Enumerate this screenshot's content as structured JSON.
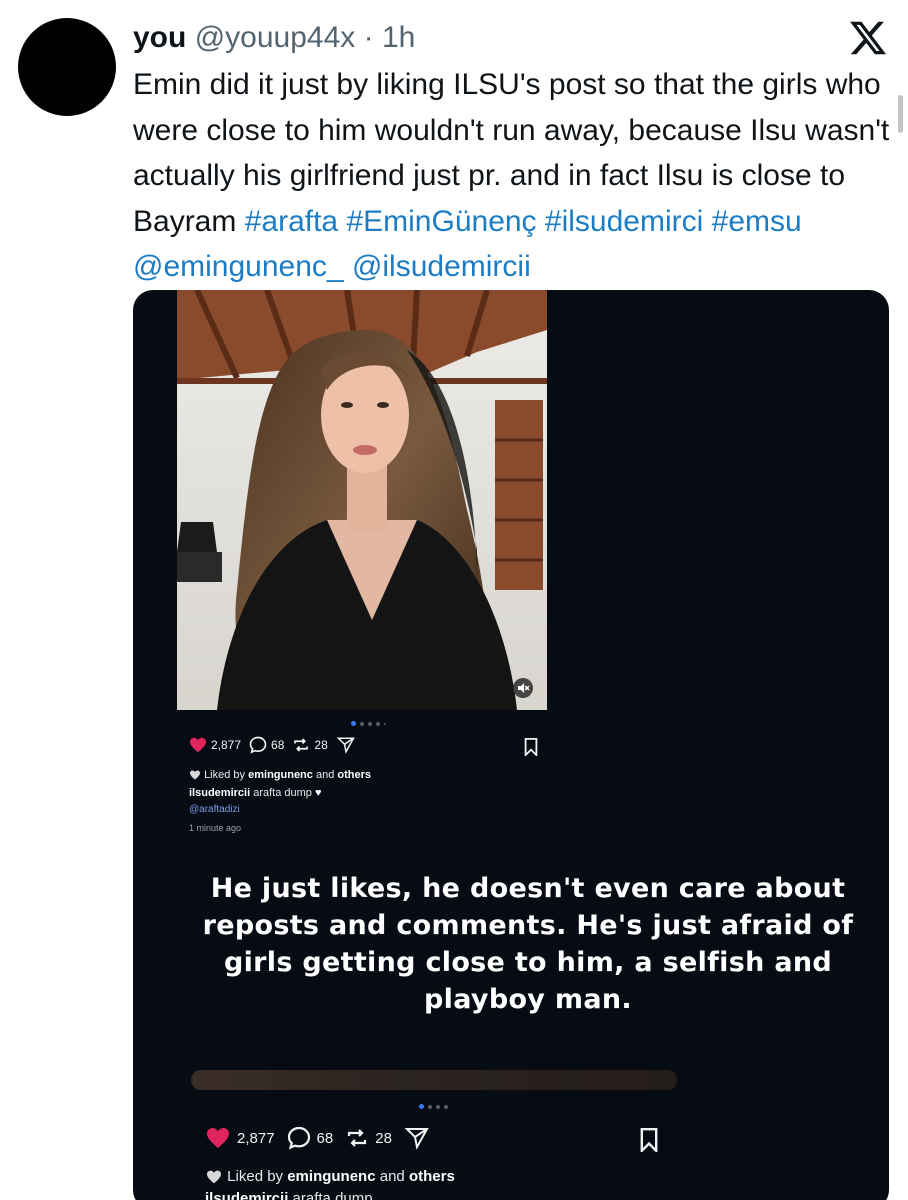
{
  "tweet": {
    "display_name": "you",
    "handle": "@youup44x",
    "separator": "·",
    "time": "1h",
    "text_plain": "Emin did it just by liking ILSU's post so that the girls who were close to him wouldn't run away, because Ilsu wasn't actually his girlfriend just pr. and in fact Ilsu is close to Bayram",
    "hashtags": [
      "#arafta",
      "#EminGünenç",
      "#ilsudemirci",
      "#emsu"
    ],
    "mentions": [
      "@emingunenc_",
      "@ilsudemircii"
    ]
  },
  "brand": {
    "logo_icon": "x-logo-icon"
  },
  "embedded_post": {
    "likes": "2,877",
    "comments": "68",
    "reposts": "28",
    "liked_by_prefix": "Liked by",
    "liked_by_user": "emingunenc",
    "liked_by_and": "and",
    "liked_by_others": "others",
    "caption_user": "ilsudemircii",
    "caption_text": "arafta dump",
    "caption_mention": "@araftadizi",
    "posted_time": "1 minute ago",
    "overlay_text": "He just likes, he doesn't even care about reposts and comments. He's just afraid of girls getting close to him, a selfish and playboy man.",
    "second_caption_user": "ilsudemircii",
    "second_caption_text": "arafta dump"
  },
  "colors": {
    "link": "#1d7dc4",
    "like_heart": "#e0245e",
    "media_bg": "#070b14"
  }
}
